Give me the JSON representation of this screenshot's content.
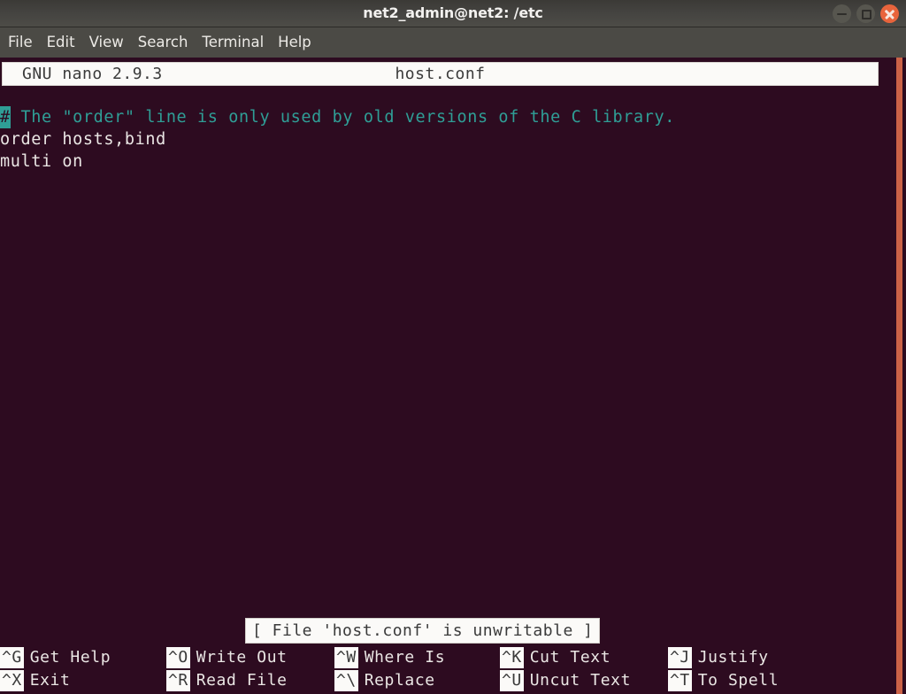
{
  "window": {
    "title": "net2_admin@net2: /etc",
    "controls": [
      {
        "name": "minimize",
        "glyph": "–",
        "color": "#57564f"
      },
      {
        "name": "maximize",
        "glyph": "□",
        "color": "#57564f"
      },
      {
        "name": "close",
        "glyph": "×",
        "color": "#e8643c"
      }
    ]
  },
  "menubar": {
    "items": [
      {
        "label": "File"
      },
      {
        "label": "Edit"
      },
      {
        "label": "View"
      },
      {
        "label": "Search"
      },
      {
        "label": "Terminal"
      },
      {
        "label": "Help"
      }
    ]
  },
  "nano": {
    "version_text": "GNU nano 2.9.3",
    "filename": "host.conf",
    "status_message": "[ File 'host.conf' is unwritable ]",
    "buffer": {
      "lines": [
        {
          "type": "comment",
          "cursor_char": "#",
          "text": " The \"order\" line is only used by old versions of the C library."
        },
        {
          "type": "plain",
          "text": "order hosts,bind"
        },
        {
          "type": "plain",
          "text": "multi on"
        }
      ]
    },
    "shortcuts": [
      {
        "key": "^G",
        "label": "Get Help",
        "key2": "^X",
        "label2": "Exit"
      },
      {
        "key": "^O",
        "label": "Write Out",
        "key2": "^R",
        "label2": "Read File"
      },
      {
        "key": "^W",
        "label": "Where Is",
        "key2": "^\\",
        "label2": "Replace"
      },
      {
        "key": "^K",
        "label": "Cut Text",
        "key2": "^U",
        "label2": "Uncut Text"
      },
      {
        "key": "^J",
        "label": "Justify",
        "key2": "^T",
        "label2": "To Spell"
      }
    ]
  },
  "colors": {
    "terminal_background": "#2d0b20",
    "titlebar": "#44433f",
    "menubar": "#4b4a45",
    "comment_text": "#2f9e96",
    "plain_text": "#eae6e4",
    "inverse_background": "#fbfaf8",
    "window_border_accent": "#d4674a",
    "close_button": "#e8643c"
  }
}
